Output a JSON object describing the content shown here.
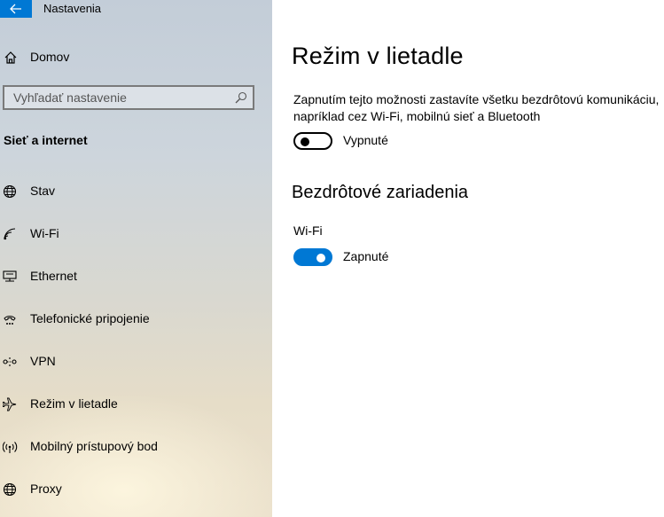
{
  "window": {
    "title": "Nastavenia"
  },
  "sidebar": {
    "home_label": "Domov",
    "search_placeholder": "Vyhľadať nastavenie",
    "section_heading": "Sieť a internet",
    "items": [
      {
        "label": "Stav",
        "icon": "globe-icon"
      },
      {
        "label": "Wi-Fi",
        "icon": "wifi-icon"
      },
      {
        "label": "Ethernet",
        "icon": "ethernet-icon"
      },
      {
        "label": "Telefonické pripojenie",
        "icon": "dialup-icon"
      },
      {
        "label": "VPN",
        "icon": "vpn-icon"
      },
      {
        "label": "Režim v lietadle",
        "icon": "airplane-icon"
      },
      {
        "label": "Mobilný prístupový bod",
        "icon": "hotspot-icon"
      },
      {
        "label": "Proxy",
        "icon": "globe-icon"
      }
    ]
  },
  "main": {
    "title": "Režim v lietadle",
    "description_line1": "Zapnutím tejto možnosti zastavíte všetku bezdrôtovú komunikáciu,",
    "description_line2": "napríklad cez Wi-Fi, mobilnú sieť a Bluetooth",
    "airplane_toggle": {
      "state": "off",
      "label": "Vypnuté"
    },
    "wireless_heading": "Bezdrôtové zariadenia",
    "wifi": {
      "label": "Wi-Fi",
      "state": "on",
      "toggle_label": "Zapnuté"
    }
  },
  "colors": {
    "accent": "#0078d4"
  }
}
